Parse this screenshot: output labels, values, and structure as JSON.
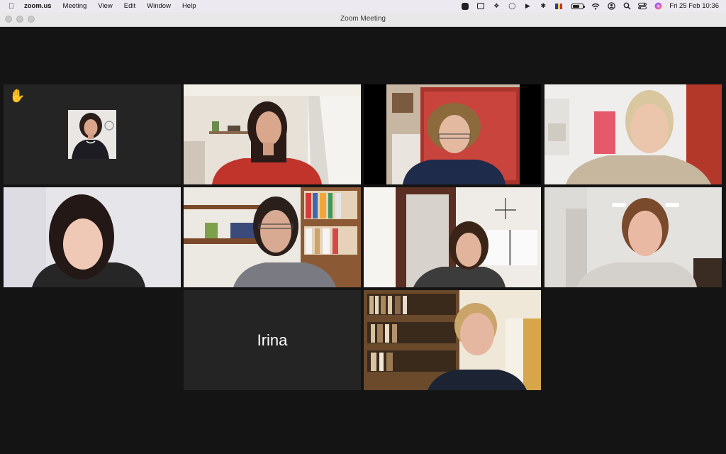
{
  "menubar": {
    "apple_icon": "apple-logo-icon",
    "app_name": "zoom.us",
    "menus": [
      "Meeting",
      "View",
      "Edit",
      "Window",
      "Help"
    ],
    "status_icons": [
      "zoom-icon",
      "clipboard-icon",
      "dropbox-icon",
      "vpn-shield-icon",
      "volume-icon",
      "bluetooth-icon",
      "flag-icon",
      "battery-icon",
      "wifi-icon",
      "user-icon",
      "search-icon",
      "control-center-icon",
      "siri-icon"
    ],
    "clock": "Fri 25 Feb  10:36"
  },
  "window": {
    "title": "Zoom Meeting"
  },
  "gallery": {
    "participants": [
      {
        "id": "p1",
        "video": false,
        "raised_hand": true,
        "hand_icon": "raised-hand-icon"
      },
      {
        "id": "p2",
        "video": true
      },
      {
        "id": "p3",
        "video": true
      },
      {
        "id": "p4",
        "video": true
      },
      {
        "id": "p5",
        "video": true
      },
      {
        "id": "p6",
        "video": true,
        "active_speaker": true
      },
      {
        "id": "p7",
        "video": true
      },
      {
        "id": "p8",
        "video": true
      },
      {
        "id": "p9",
        "video": false,
        "name": "Irina"
      },
      {
        "id": "p10",
        "video": true
      }
    ],
    "colors": {
      "background": "#141414",
      "tile_off": "#2b2b2b",
      "active_speaker_border": "#d6e07a",
      "raised_hand": "#f6c23a"
    }
  }
}
